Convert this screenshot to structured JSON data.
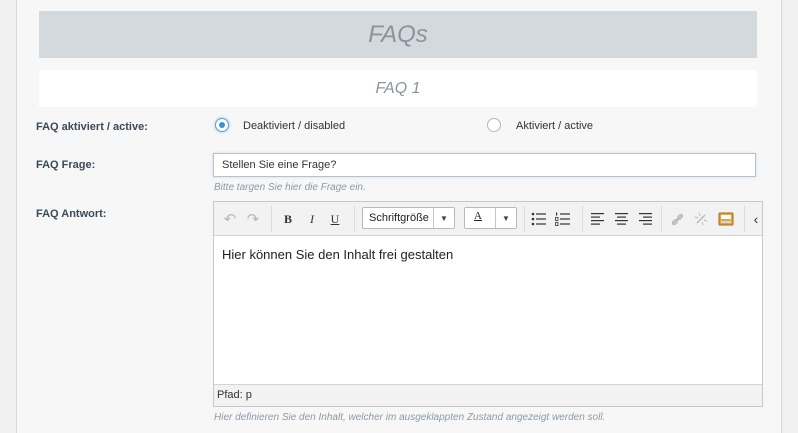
{
  "section": {
    "title": "FAQs",
    "subtitle": "FAQ 1"
  },
  "active_field": {
    "label": "FAQ aktiviert / active:",
    "options": [
      {
        "label": "Deaktiviert / disabled",
        "selected": true
      },
      {
        "label": "Aktiviert / active",
        "selected": false
      }
    ]
  },
  "question_field": {
    "label": "FAQ Frage:",
    "value": "Stellen Sie eine Frage?",
    "hint": "Bitte targen Sie hier die Frage ein."
  },
  "answer_field": {
    "label": "FAQ Antwort:",
    "font_size_select": "Schriftgröße",
    "font_color_label": "A",
    "font_color_value": "#333333",
    "content": "Hier können Sie den Inhalt frei gestalten",
    "path_label": "Pfad: p",
    "hint": "Hier definieren Sie den Inhalt, welcher im ausgeklappten Zustand angezeigt werden soll."
  },
  "toolbar": {
    "undo": "↶",
    "redo": "↷",
    "bold": "B",
    "italic": "I",
    "underline": "U"
  }
}
